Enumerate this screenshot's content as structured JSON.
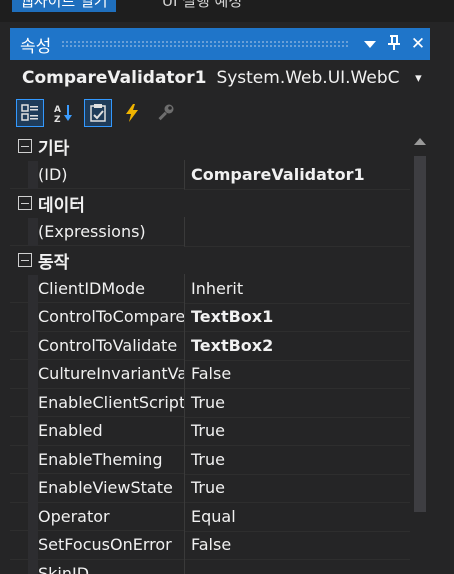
{
  "top_tabs": {
    "active": "웹사이트 열기",
    "inactive": "UI 실행 예정"
  },
  "panel": {
    "title": "속성",
    "dropdown_icon": "triangle-down-icon",
    "pin_label": "ᅲ",
    "close_label": "✕"
  },
  "object_selector": {
    "name": "CompareValidator1",
    "type": "System.Web.UI.WebC",
    "dropdown": "▾"
  },
  "toolbar": {
    "tools": [
      "categorized-icon",
      "alphabetical-icon",
      "properties-icon",
      "events-icon",
      "property-pages-icon"
    ]
  },
  "categories": {
    "misc": {
      "label": "기타"
    },
    "data": {
      "label": "데이터"
    },
    "behavior": {
      "label": "동작"
    }
  },
  "rows": {
    "id": {
      "name": "(ID)",
      "value": "CompareValidator1"
    },
    "expressions": {
      "name": "(Expressions)",
      "value": ""
    },
    "clientidmode": {
      "name": "ClientIDMode",
      "value": "Inherit"
    },
    "controltocompare": {
      "name": "ControlToCompare",
      "value": "TextBox1"
    },
    "controltovalidate": {
      "name": "ControlToValidate",
      "value": "TextBox2"
    },
    "cultureinvariant": {
      "name": "CultureInvariantValu",
      "value": "False"
    },
    "enableclientscript": {
      "name": "EnableClientScript",
      "value": "True"
    },
    "enabled": {
      "name": "Enabled",
      "value": "True"
    },
    "enabletheming": {
      "name": "EnableTheming",
      "value": "True"
    },
    "enableviewstate": {
      "name": "EnableViewState",
      "value": "True"
    },
    "operator": {
      "name": "Operator",
      "value": "Equal"
    },
    "setfocus": {
      "name": "SetFocusOnError",
      "value": "False"
    },
    "skinid": {
      "name": "SkinID",
      "value": ""
    }
  }
}
